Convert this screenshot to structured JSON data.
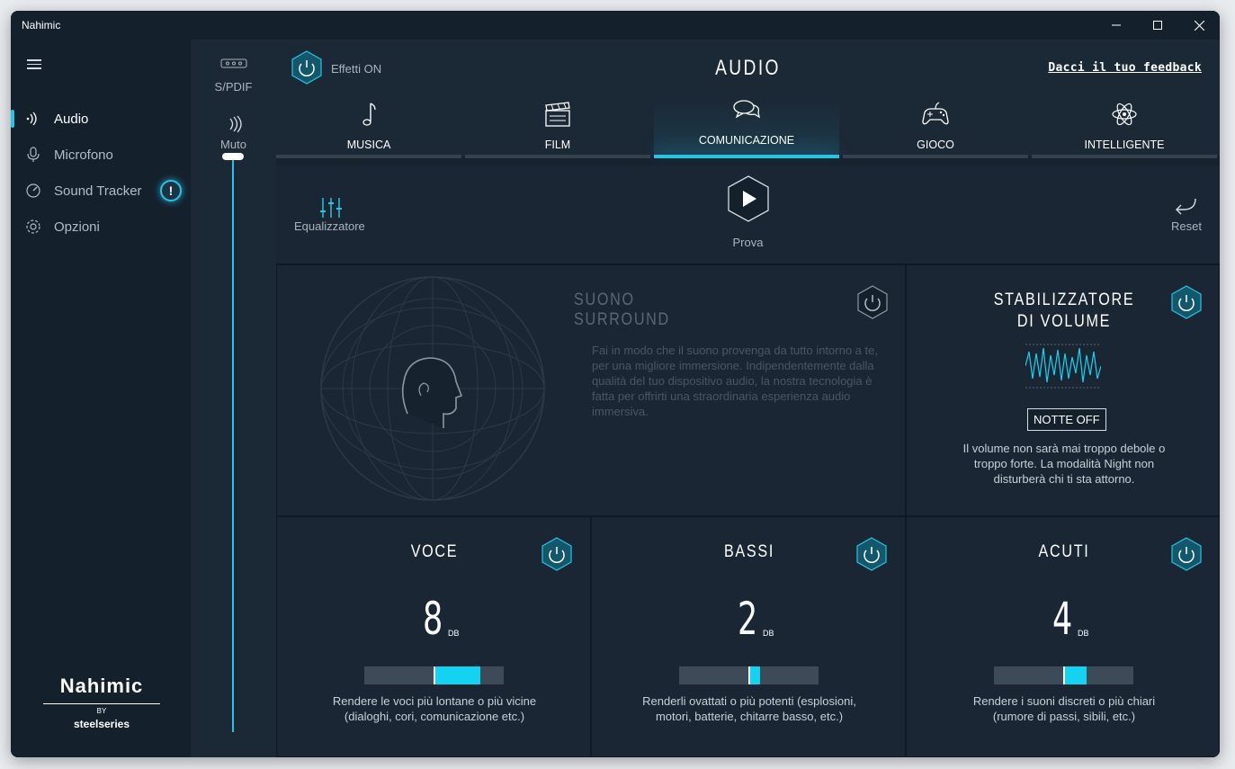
{
  "window": {
    "title": "Nahimic"
  },
  "sidebar": {
    "items": [
      {
        "label": "Audio",
        "icon": "audio-wave-icon",
        "active": true
      },
      {
        "label": "Microfono",
        "icon": "microphone-icon",
        "active": false
      },
      {
        "label": "Sound Tracker",
        "icon": "sound-tracker-icon",
        "active": false,
        "badge": "!"
      },
      {
        "label": "Opzioni",
        "icon": "gear-icon",
        "active": false
      }
    ],
    "brand": {
      "name": "Nahimic",
      "by": "BY",
      "partner": "steelseries"
    }
  },
  "devices": [
    {
      "label": "S/PDIF",
      "icon": "spdif-icon"
    },
    {
      "label": "Muto",
      "icon": "speaker-icon"
    }
  ],
  "volume": {
    "level": 1.0
  },
  "header": {
    "effects_label": "Effetti ON",
    "title": "AUDIO",
    "feedback": "Dacci il tuo feedback"
  },
  "tabs": [
    {
      "label": "MUSICA",
      "icon": "music-note-icon",
      "active": false
    },
    {
      "label": "FILM",
      "icon": "clapperboard-icon",
      "active": false
    },
    {
      "label": "COMUNICAZIONE",
      "icon": "chat-bubbles-icon",
      "active": true
    },
    {
      "label": "GIOCO",
      "icon": "gamepad-icon",
      "active": false
    },
    {
      "label": "INTELLIGENTE",
      "icon": "atom-icon",
      "active": false
    }
  ],
  "actions": {
    "equalizer": "Equalizzatore",
    "play": "Prova",
    "reset": "Reset"
  },
  "surround": {
    "title": "SUONO SURROUND",
    "desc": "Fai in modo che il suono provenga da tutto intorno a te, per una migliore immersione. Indipendentemente dalla qualità del tuo dispositivo audio, la nostra tecnologia è fatta per offrirti una straordinaria esperienza audio immersiva.",
    "enabled": false
  },
  "stabilizer": {
    "title_line1": "STABILIZZATORE",
    "title_line2": "DI VOLUME",
    "night_button": "NOTTE OFF",
    "desc": "Il volume non sarà mai troppo debole o troppo forte. La modalità Night non disturberà chi ti sta attorno.",
    "enabled": true
  },
  "controls": [
    {
      "title": "VOCE",
      "value": "8",
      "unit": "DB",
      "level": 8,
      "desc": "Rendere le voci più lontane o più vicine (dialoghi, cori, comunicazione etc.)",
      "enabled": true
    },
    {
      "title": "BASSI",
      "value": "2",
      "unit": "DB",
      "level": 2,
      "desc": "Renderli ovattati o più potenti (esplosioni, motori, batterie, chitarre basso, etc.)",
      "enabled": true
    },
    {
      "title": "ACUTI",
      "value": "4",
      "unit": "DB",
      "level": 4,
      "desc": "Rendere i suoni discreti o più chiari (rumore di passi, sibili, etc.)",
      "enabled": true
    }
  ],
  "colors": {
    "accent": "#29c3e3",
    "fill": "#14d3f1",
    "background": "#17222f"
  }
}
